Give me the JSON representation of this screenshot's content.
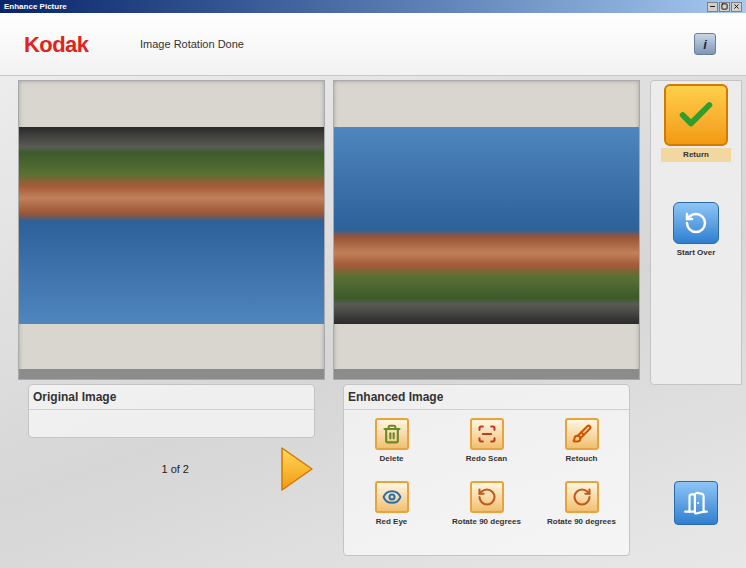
{
  "window": {
    "title": "Enhance Picture"
  },
  "header": {
    "logo": "Kodak",
    "status": "Image Rotation Done",
    "info": "i"
  },
  "original": {
    "label": "Original Image",
    "page": "1 of 2"
  },
  "enhanced": {
    "label": "Enhanced Image",
    "tools": [
      {
        "label": "Delete"
      },
      {
        "label": "Redo Scan"
      },
      {
        "label": "Retouch"
      },
      {
        "label": "Red Eye"
      },
      {
        "label": "Rotate 90 degrees"
      },
      {
        "label": "Rotate 90 degrees"
      }
    ]
  },
  "sidebar": [
    {
      "label": "Return"
    },
    {
      "label": "Start Over"
    }
  ]
}
